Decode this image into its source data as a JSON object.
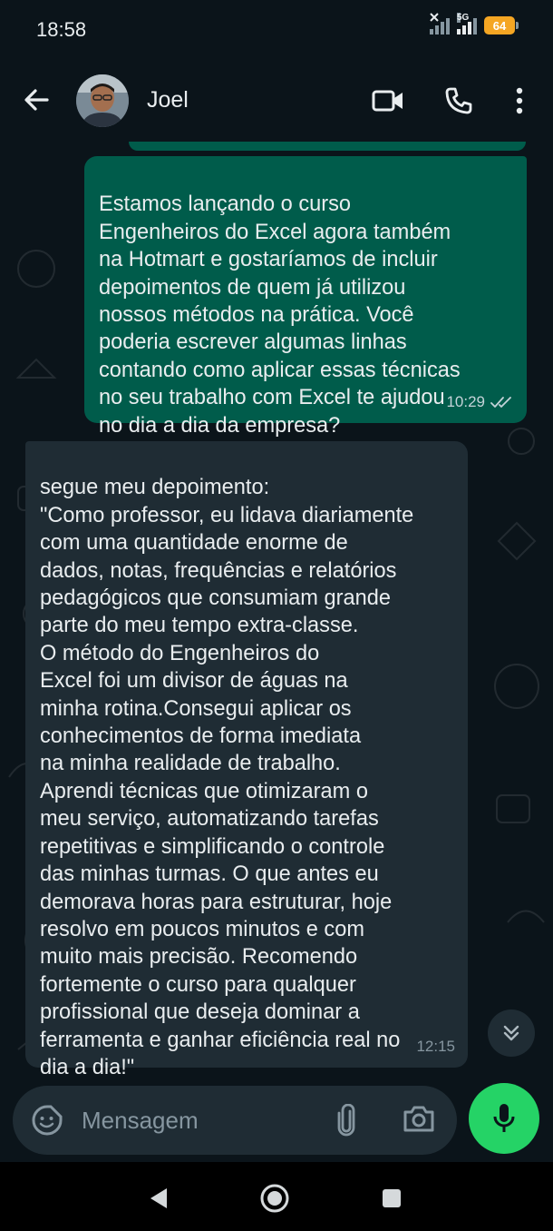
{
  "status_bar": {
    "time": "18:58",
    "network": "5G",
    "battery": "64"
  },
  "header": {
    "contact_name": "Joel"
  },
  "messages": [
    {
      "direction": "outgoing",
      "text": "Estamos lançando o curso\nEngenheiros do Excel agora também\nna Hotmart e gostaríamos de incluir\ndepoimentos de quem já utilizou\nnossos métodos na prática. Você\npoderia escrever algumas linhas\ncontando como aplicar essas técnicas\nno seu trabalho com Excel te ajudou\nno dia a dia da empresa?",
      "time": "10:29",
      "status": "read"
    },
    {
      "direction": "incoming",
      "text": "segue meu depoimento:\n\"Como professor, eu lidava diariamente\ncom uma quantidade enorme de\ndados, notas, frequências e relatórios\npedagógicos que consumiam grande\nparte do meu tempo extra-classe.\nO método do Engenheiros do\nExcel foi um divisor de águas na\nminha rotina.Consegui aplicar os\nconhecimentos de forma imediata\nna minha realidade de trabalho.\nAprendi técnicas que otimizaram o\nmeu serviço, automatizando tarefas\nrepetitivas e simplificando o controle\ndas minhas turmas. O que antes eu\ndemorava horas para estruturar, hoje\nresolvo em poucos minutos e com\nmuito mais precisão. Recomendo\nfortemente o curso para qualquer\nprofissional que deseja dominar a\nferramenta e ganhar eficiência real no\ndia a dia!\"",
      "time": "12:15"
    }
  ],
  "composer": {
    "placeholder": "Mensagem",
    "value": ""
  },
  "icons": {
    "back": "arrow-left-icon",
    "video": "video-camera-icon",
    "call": "phone-icon",
    "menu": "more-vertical-icon",
    "emoji": "sticker-icon",
    "attach": "paperclip-icon",
    "camera": "camera-icon",
    "mic": "microphone-icon",
    "scroll": "double-chevron-down-icon"
  },
  "colors": {
    "background": "#0b141a",
    "outgoing_bubble": "#005c4b",
    "incoming_bubble": "#1f2c34",
    "accent": "#25d366",
    "read_ticks": "#c4d3d9",
    "battery": "#f5a623"
  }
}
